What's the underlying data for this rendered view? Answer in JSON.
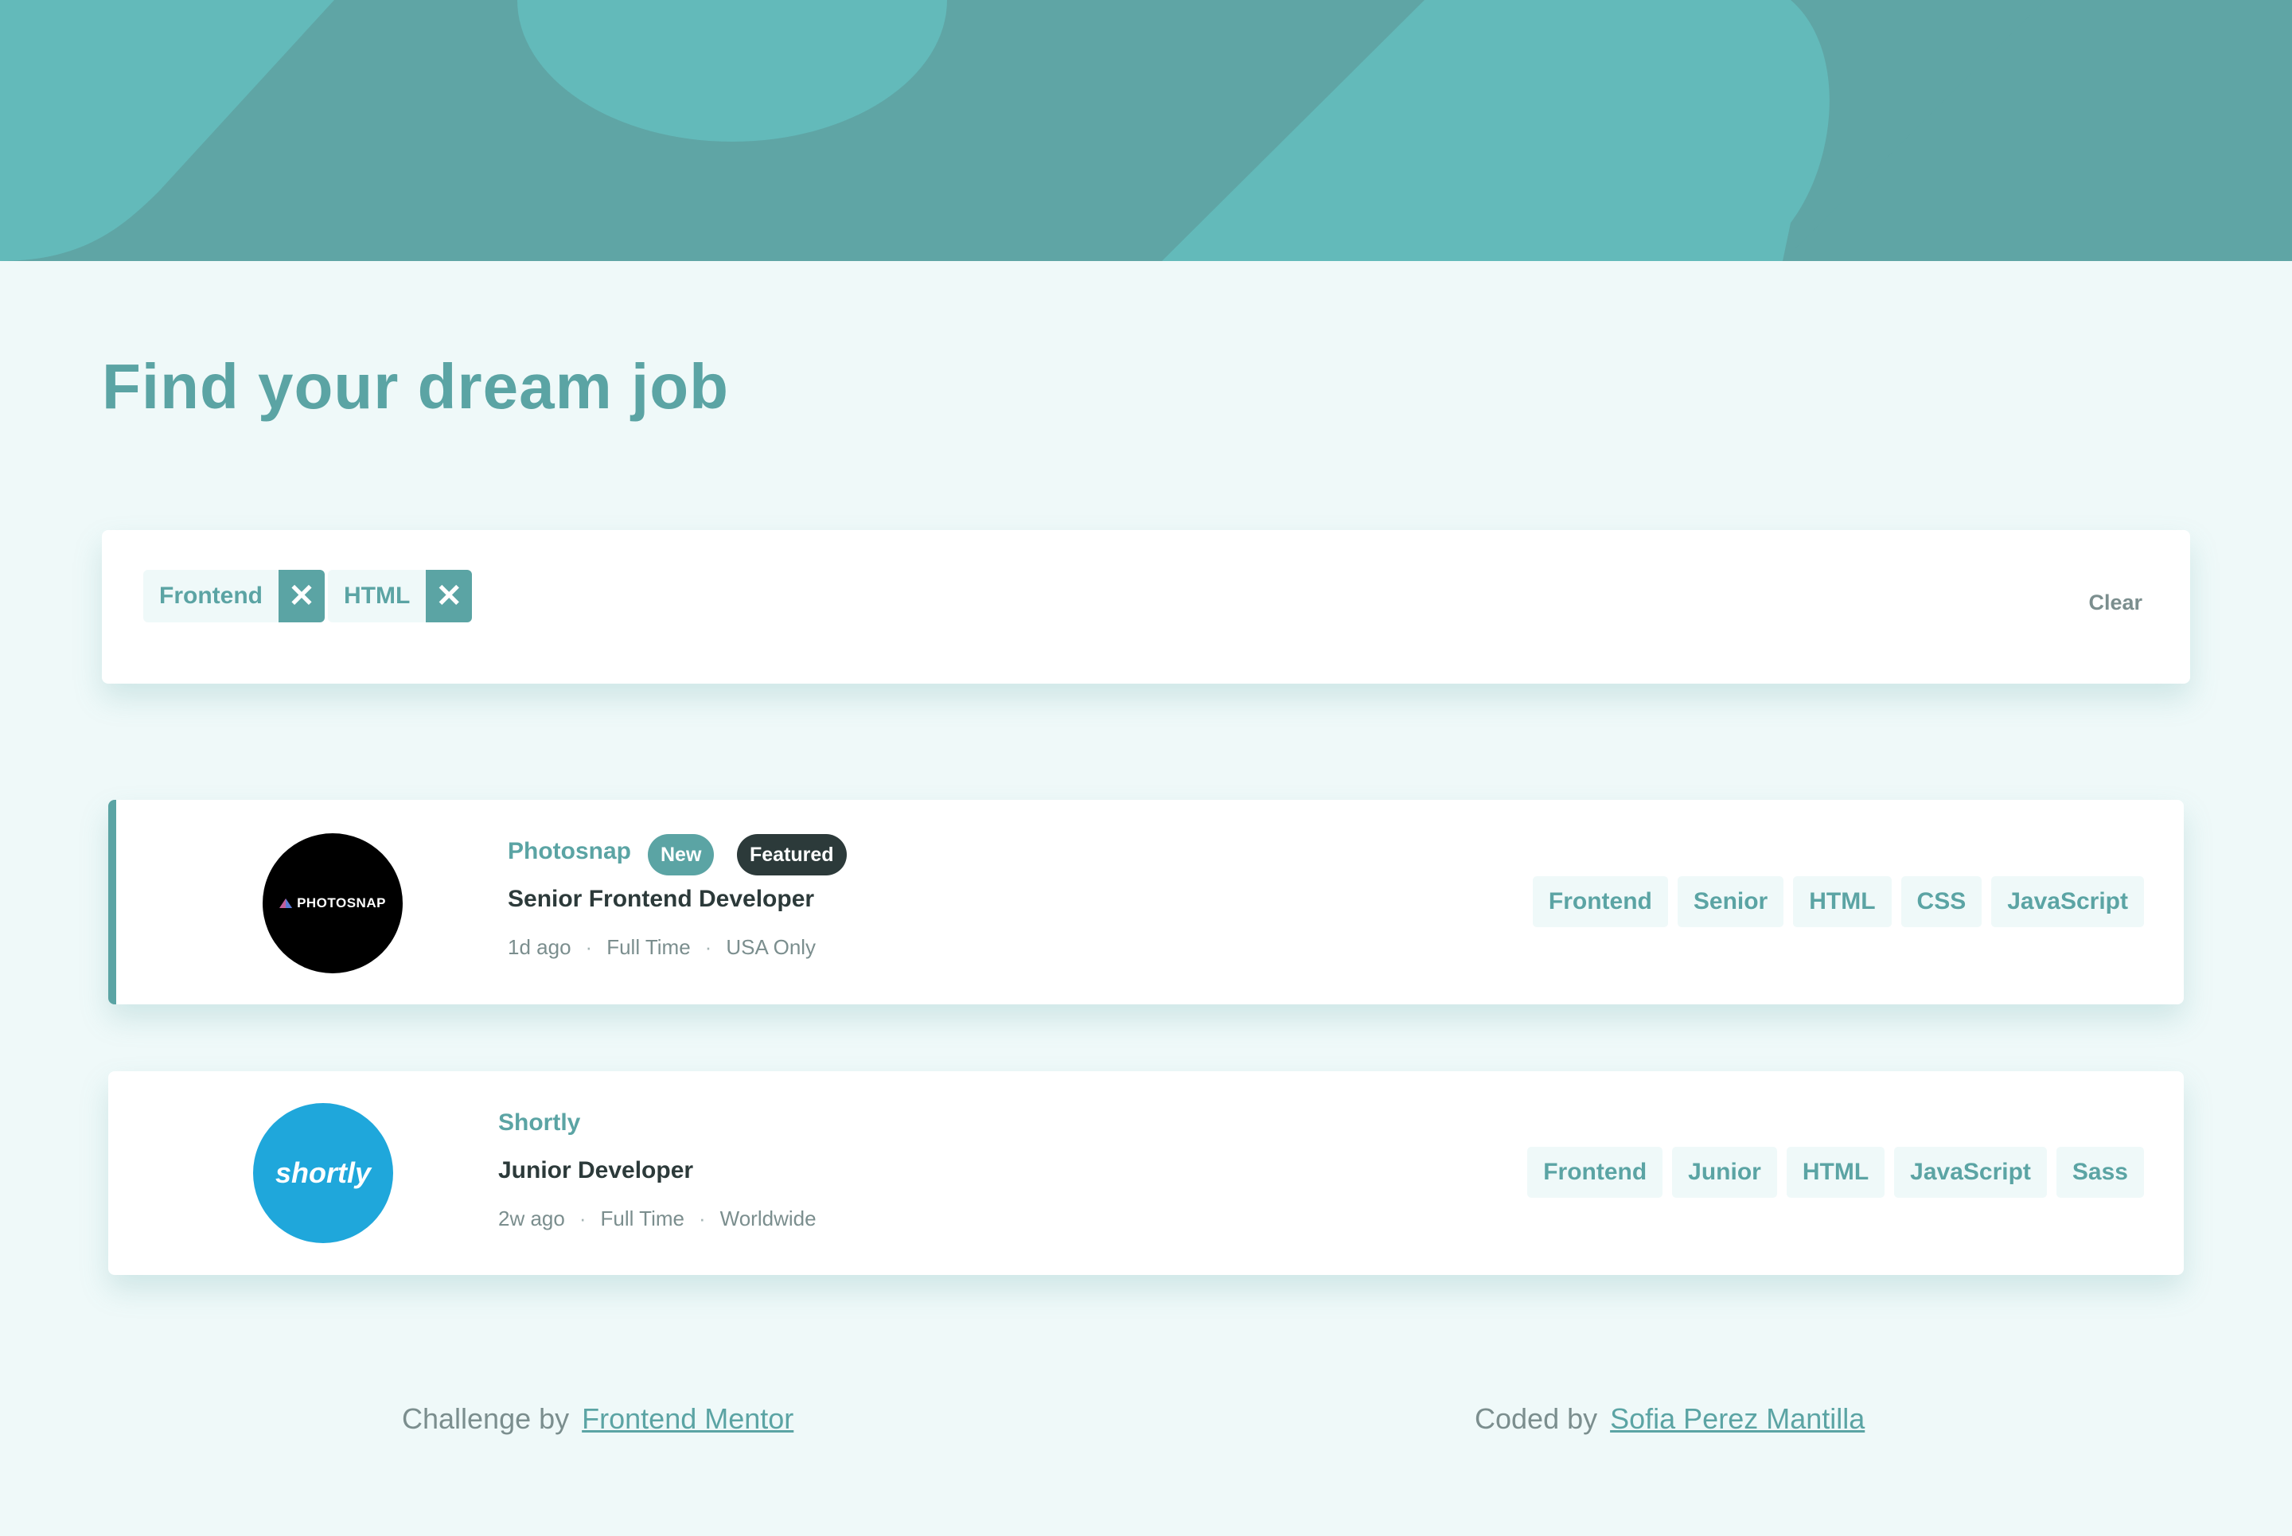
{
  "page": {
    "title": "Find your dream job"
  },
  "colors": {
    "primary": "#5ba4a4",
    "dark": "#2c3a3a",
    "background": "#eff9f9",
    "banner": "#5fa5a5",
    "banner_light": "#63baba"
  },
  "filters": {
    "active": [
      {
        "label": "Frontend",
        "remove_icon": "close-icon"
      },
      {
        "label": "HTML",
        "remove_icon": "close-icon"
      }
    ],
    "clear_label": "Clear"
  },
  "jobs": [
    {
      "company": "Photosnap",
      "logo_text": "PHOTOSNAP",
      "new_label": "New",
      "featured_label": "Featured",
      "position": "Senior Frontend Developer",
      "posted": "1d ago",
      "contract": "Full Time",
      "location": "USA Only",
      "tags": [
        "Frontend",
        "Senior",
        "HTML",
        "CSS",
        "JavaScript"
      ]
    },
    {
      "company": "Shortly",
      "logo_text": "shortly",
      "position": "Junior Developer",
      "posted": "2w ago",
      "contract": "Full Time",
      "location": "Worldwide",
      "tags": [
        "Frontend",
        "Junior",
        "HTML",
        "JavaScript",
        "Sass"
      ]
    }
  ],
  "footer": {
    "challenge_prefix": "Challenge by",
    "challenge_link": "Frontend Mentor",
    "coded_prefix": "Coded by",
    "coded_link": "Sofia Perez Mantilla"
  }
}
